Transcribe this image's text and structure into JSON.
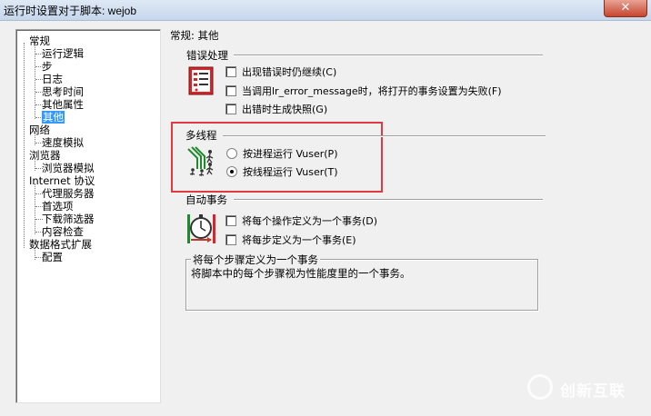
{
  "window": {
    "title": "运行时设置对于脚本: wejob",
    "close_glyph": "✕"
  },
  "tree": {
    "items": [
      {
        "label": "常规",
        "level": 0
      },
      {
        "label": "运行逻辑",
        "level": 1
      },
      {
        "label": "步",
        "level": 1
      },
      {
        "label": "日志",
        "level": 1
      },
      {
        "label": "思考时间",
        "level": 1
      },
      {
        "label": "其他属性",
        "level": 1
      },
      {
        "label": "其他",
        "level": 1,
        "selected": true
      },
      {
        "label": "网络",
        "level": 0
      },
      {
        "label": "速度模拟",
        "level": 1
      },
      {
        "label": "浏览器",
        "level": 0
      },
      {
        "label": "浏览器模拟",
        "level": 1
      },
      {
        "label": "Internet 协议",
        "level": 0
      },
      {
        "label": "代理服务器",
        "level": 1
      },
      {
        "label": "首选项",
        "level": 1
      },
      {
        "label": "下载筛选器",
        "level": 1
      },
      {
        "label": "内容检查",
        "level": 1
      },
      {
        "label": "数据格式扩展",
        "level": 0
      },
      {
        "label": "配置",
        "level": 1
      }
    ]
  },
  "panel": {
    "title": "常规: 其他",
    "error_handling": {
      "label": "错误处理",
      "options": [
        {
          "label": "出现错误时仍继续(C)",
          "checked": false
        },
        {
          "label": "当调用lr_error_message时，将打开的事务设置为失败(F)",
          "checked": false
        },
        {
          "label": "出错时生成快照(G)",
          "checked": false
        }
      ]
    },
    "multithreading": {
      "label": "多线程",
      "options": [
        {
          "label": "按进程运行 Vuser(P)",
          "selected": false
        },
        {
          "label": "按线程运行 Vuser(T)",
          "selected": true
        }
      ]
    },
    "auto_transactions": {
      "label": "自动事务",
      "options": [
        {
          "label": "将每个操作定义为一个事务(D)",
          "checked": false
        },
        {
          "label": "将每步定义为一个事务(E)",
          "checked": false
        }
      ]
    },
    "description": {
      "title": "将每个步骤定义为一个事务",
      "text": "将脚本中的每个步骤视为性能度里的一个事务。"
    }
  },
  "watermark": {
    "text": "创新互联"
  },
  "colors": {
    "highlight": "#e0393e",
    "selection": "#3399ff"
  }
}
